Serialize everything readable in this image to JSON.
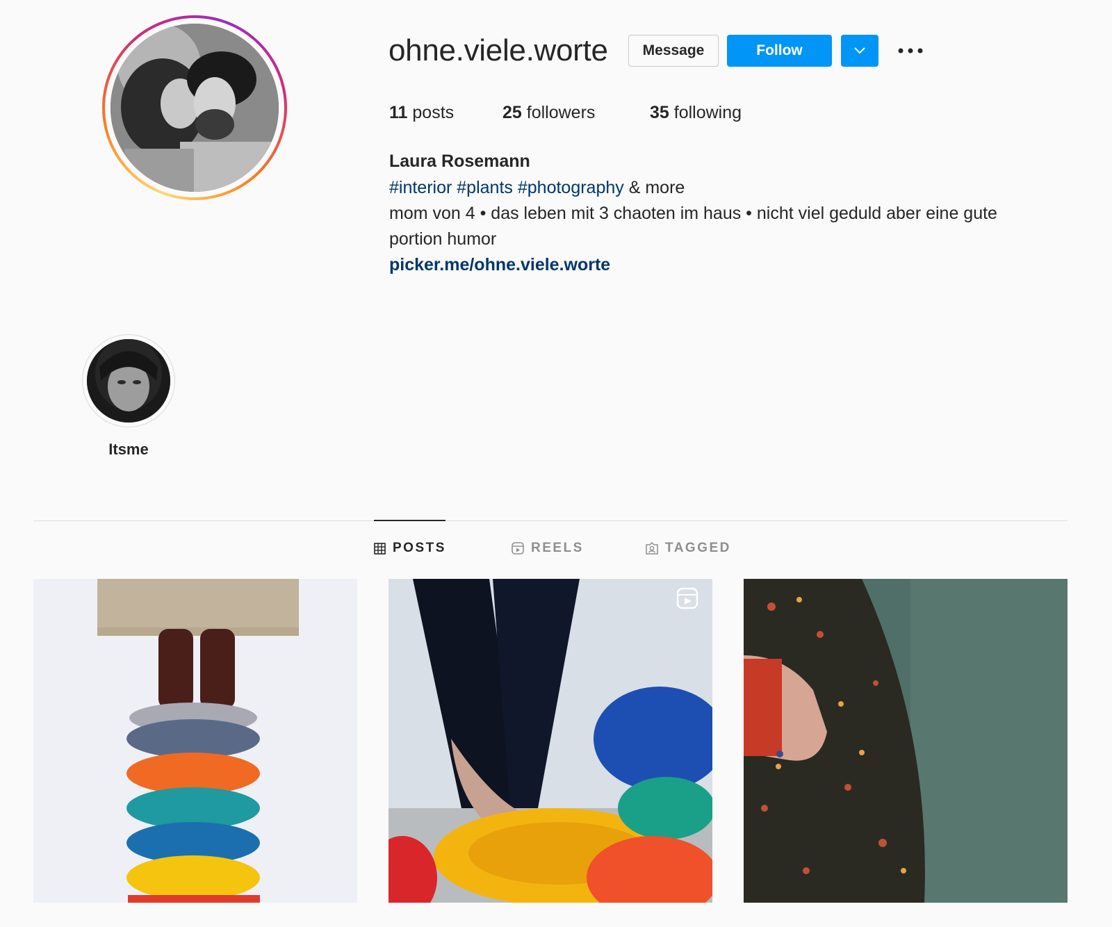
{
  "profile": {
    "username": "ohne.viele.worte",
    "message_label": "Message",
    "follow_label": "Follow",
    "stats": {
      "posts_count": "11",
      "posts_label": "posts",
      "followers_count": "25",
      "followers_label": "followers",
      "following_count": "35",
      "following_label": "following"
    },
    "full_name": "Laura Rosemann",
    "bio": {
      "hashtags": [
        "#interior",
        "#plants",
        "#photography"
      ],
      "hashtag_suffix": "& more",
      "line2": "mom von 4 • das leben mit 3 chaoten im haus • nicht viel geduld aber eine gute",
      "line3": "portion humor",
      "link": "picker.me/ohne.viele.worte"
    }
  },
  "highlights": [
    {
      "label": "Itsme"
    }
  ],
  "tabs": [
    {
      "label": "POSTS",
      "icon": "grid-icon",
      "active": true
    },
    {
      "label": "REELS",
      "icon": "reels-icon",
      "active": false
    },
    {
      "label": "TAGGED",
      "icon": "tagged-icon",
      "active": false
    }
  ],
  "posts": [
    {
      "description": "stacked stepping stones",
      "is_reel": false
    },
    {
      "description": "feet over colorful stepping stones",
      "is_reel": true
    },
    {
      "description": "hand holding red cup",
      "is_reel": false
    }
  ],
  "colors": {
    "accent": "#0095f6",
    "link": "#00376b",
    "text": "#262626",
    "muted": "#8e8e8e",
    "background": "#fafafa"
  }
}
